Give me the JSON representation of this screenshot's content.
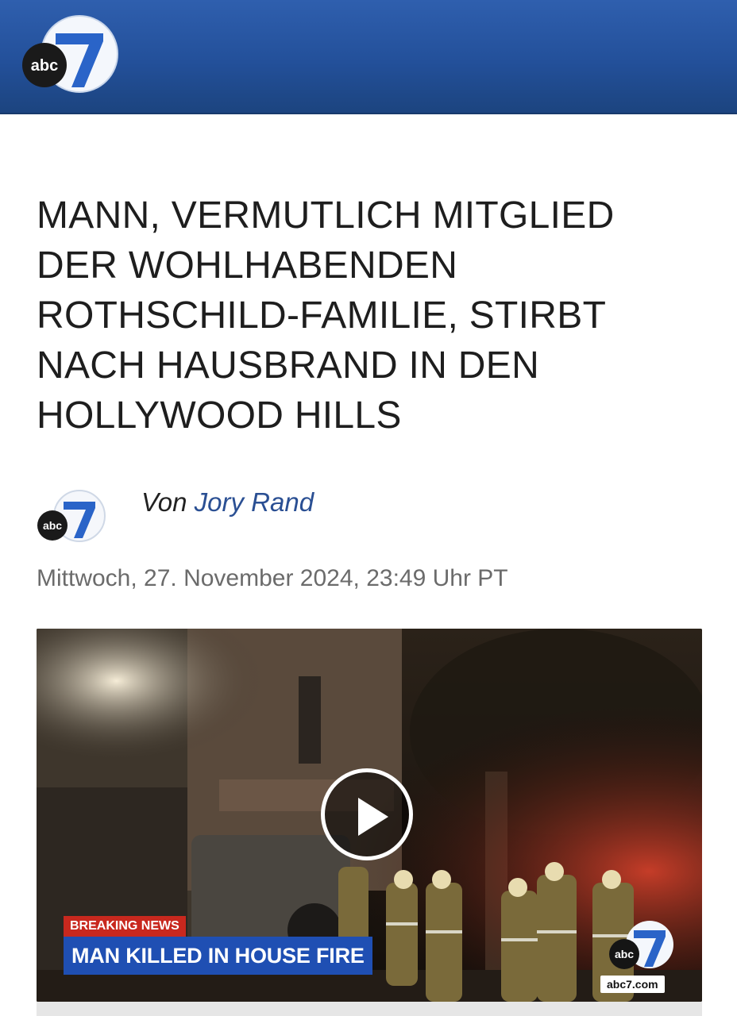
{
  "brand": {
    "name": "abc7",
    "logo_text": "abc",
    "logo_number": "7",
    "accent": "#23509a"
  },
  "article": {
    "headline": "MANN, VERMUTLICH MITGLIED DER WOHLHABENDEN ROTHSCHILD-FAMILIE, STIRBT NACH HAUSBRAND IN DEN HOLLYWOOD HILLS",
    "byline_prefix": "Von",
    "author": "Jory Rand",
    "date": "Mittwoch, 27. November 2024, 23:49 Uhr PT"
  },
  "video": {
    "breaking_label": "BREAKING NEWS",
    "lower_third": "MAN KILLED IN HOUSE FIRE",
    "bug_text": "abc",
    "bug_number": "7",
    "site": "abc7.com",
    "play_icon": "play-icon"
  }
}
